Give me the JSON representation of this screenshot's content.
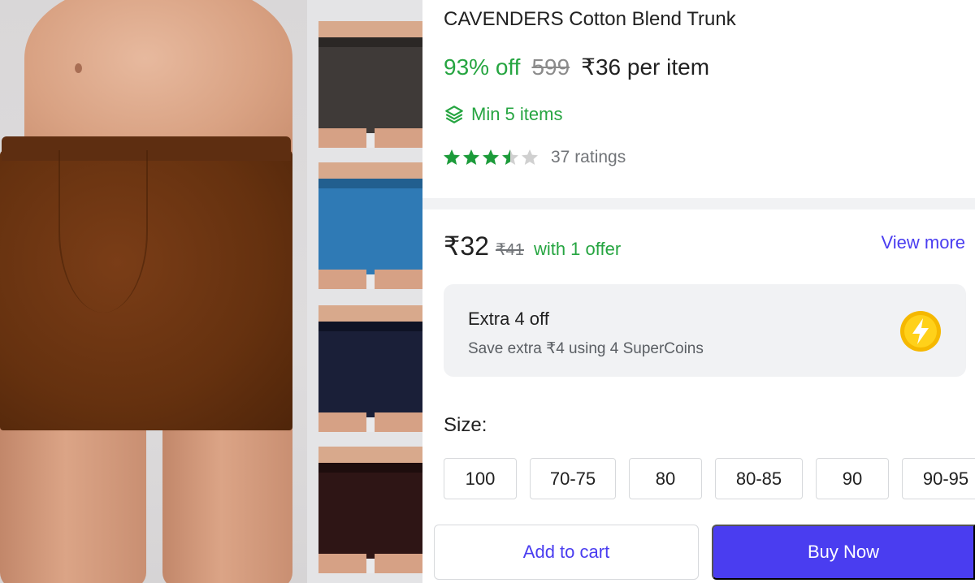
{
  "product": {
    "title": "CAVENDERS Cotton Blend Trunk",
    "discount": "93% off",
    "mrp": "599",
    "price": "₹36 per item",
    "min_items": "Min 5 items",
    "rating_value": 3.5,
    "rating_max": 5,
    "ratings_count": "37 ratings"
  },
  "thumbnails": [
    {
      "color": "#3f3a38",
      "band": "#2b2725"
    },
    {
      "color": "#2f7ab5",
      "band": "#225f8f"
    },
    {
      "color": "#1a1f38",
      "band": "#0f1325"
    },
    {
      "color": "#2e1515",
      "band": "#1e0d0d"
    }
  ],
  "main_image": {
    "color": "#65310f"
  },
  "offer": {
    "price": "₹32",
    "mrp": "₹41",
    "text": "with 1 offer",
    "view_more": "View more"
  },
  "supercoin": {
    "title": "Extra 4 off",
    "subtitle": "Save extra ₹4 using 4 SuperCoins",
    "icon": "lightning-coin-icon"
  },
  "size": {
    "label": "Size:",
    "options": [
      "100",
      "70-75",
      "80",
      "80-85",
      "90",
      "90-95"
    ]
  },
  "actions": {
    "add_to_cart": "Add to cart",
    "buy_now": "Buy Now"
  },
  "colors": {
    "green": "#26a541",
    "accent": "#4a3df0",
    "star_filled": "#1c9b3a",
    "star_empty": "#d0d0d0"
  }
}
